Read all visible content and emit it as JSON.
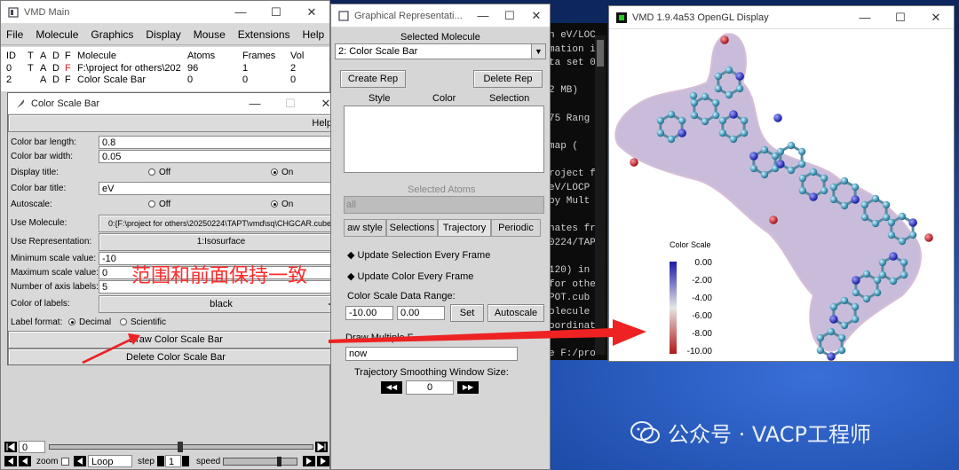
{
  "vmd_main": {
    "title": "VMD Main",
    "menu": [
      "File",
      "Molecule",
      "Graphics",
      "Display",
      "Mouse",
      "Extensions",
      "Help"
    ],
    "columns": [
      "ID",
      "T",
      "A",
      "D",
      "F",
      "Molecule",
      "Atoms",
      "Frames",
      "Vol"
    ],
    "rows": [
      {
        "id": "0",
        "t": "T",
        "a": "A",
        "d": "D",
        "f": "F",
        "name": "F:\\project for others\\202",
        "atoms": "96",
        "frames": "1",
        "vol": "2"
      },
      {
        "id": "2",
        "t": "",
        "a": "A",
        "d": "D",
        "f": "F",
        "name": "Color Scale Bar",
        "atoms": "0",
        "frames": "0",
        "vol": "0"
      }
    ],
    "frame_value": "0",
    "zoom_label": "zoom",
    "loop_value": "Loop",
    "step_label": "step",
    "step_value": "1",
    "speed_label": "speed"
  },
  "color_scale_bar": {
    "title": "Color Scale Bar",
    "help": "Help",
    "length_label": "Color bar length:",
    "length_value": "0.8",
    "width_label": "Color bar width:",
    "width_value": "0.05",
    "display_title_label": "Display title:",
    "off": "Off",
    "on": "On",
    "bar_title_label": "Color bar title:",
    "bar_title_value": "eV",
    "autoscale_label": "Autoscale:",
    "use_molecule_label": "Use Molecule:",
    "use_molecule_value": "0:{F:\\project for others\\20250224\\TAPT\\vmd\\sq\\CHGCAR.cube}",
    "use_rep_label": "Use Representation:",
    "use_rep_value": "1:Isosurface",
    "min_label": "Minimum scale value:",
    "min_value": "-10",
    "max_label": "Maximum scale value:",
    "max_value": "0",
    "num_labels_label": "Number of axis labels:",
    "num_labels_value": "5",
    "color_labels_label": "Color of labels:",
    "color_labels_value": "black",
    "label_format_label": "Label format:",
    "decimal": "Decimal",
    "scientific": "Scientific",
    "draw_button": "Draw Color Scale Bar",
    "delete_button": "Delete Color Scale Bar"
  },
  "annotation": {
    "text": "范围和前面保持一致",
    "color": "#ff2a2a"
  },
  "graph_rep": {
    "title": "Graphical Representati...",
    "selected_molecule_label": "Selected Molecule",
    "selected_molecule_value": "2: Color Scale Bar",
    "create_rep": "Create Rep",
    "delete_rep": "Delete Rep",
    "col_style": "Style",
    "col_color": "Color",
    "col_selection": "Selection",
    "selected_atoms": "Selected Atoms",
    "selected_atoms_value": "all",
    "tabs": [
      "aw style",
      "Selections",
      "Trajectory",
      "Periodic"
    ],
    "update_selection": "Update Selection Every Frame",
    "update_color": "Update Color Every Frame",
    "data_range_label": "Color Scale Data Range:",
    "range_min": "-10.00",
    "range_max": "0.00",
    "set": "Set",
    "autoscale": "Autoscale",
    "draw_multiple": "Draw Multiple F",
    "now": "now",
    "smoothing_label": "Trajectory Smoothing Window Size:",
    "smoothing_value": "0"
  },
  "terminal": {
    "lines": [
      "n eV/LOC",
      "mation i",
      "ta set 0",
      "",
      "2 MB)",
      "",
      "75  Rang",
      "",
      "map   (",
      "",
      "roject f",
      " eV/LOCP",
      " by Mult",
      "",
      "nates fr",
      "0224/TAP",
      "",
      "120) in",
      "for othe",
      "POT.cub",
      "olecule",
      "oordinat",
      "",
      "e F:/pro"
    ]
  },
  "opengl": {
    "title": "VMD 1.9.4a53 OpenGL Display",
    "scale_title": "Color Scale",
    "scale_labels": [
      "0.00",
      "-2.00",
      "-4.00",
      "-6.00",
      "-8.00",
      "-10.00"
    ]
  },
  "watermark": "公众号 · VACP工程师",
  "colors": {
    "annotation": "#ff2a2a",
    "scale_top": "#1a1aa8",
    "scale_mid": "#e6e6e6",
    "scale_bottom": "#b01818"
  }
}
